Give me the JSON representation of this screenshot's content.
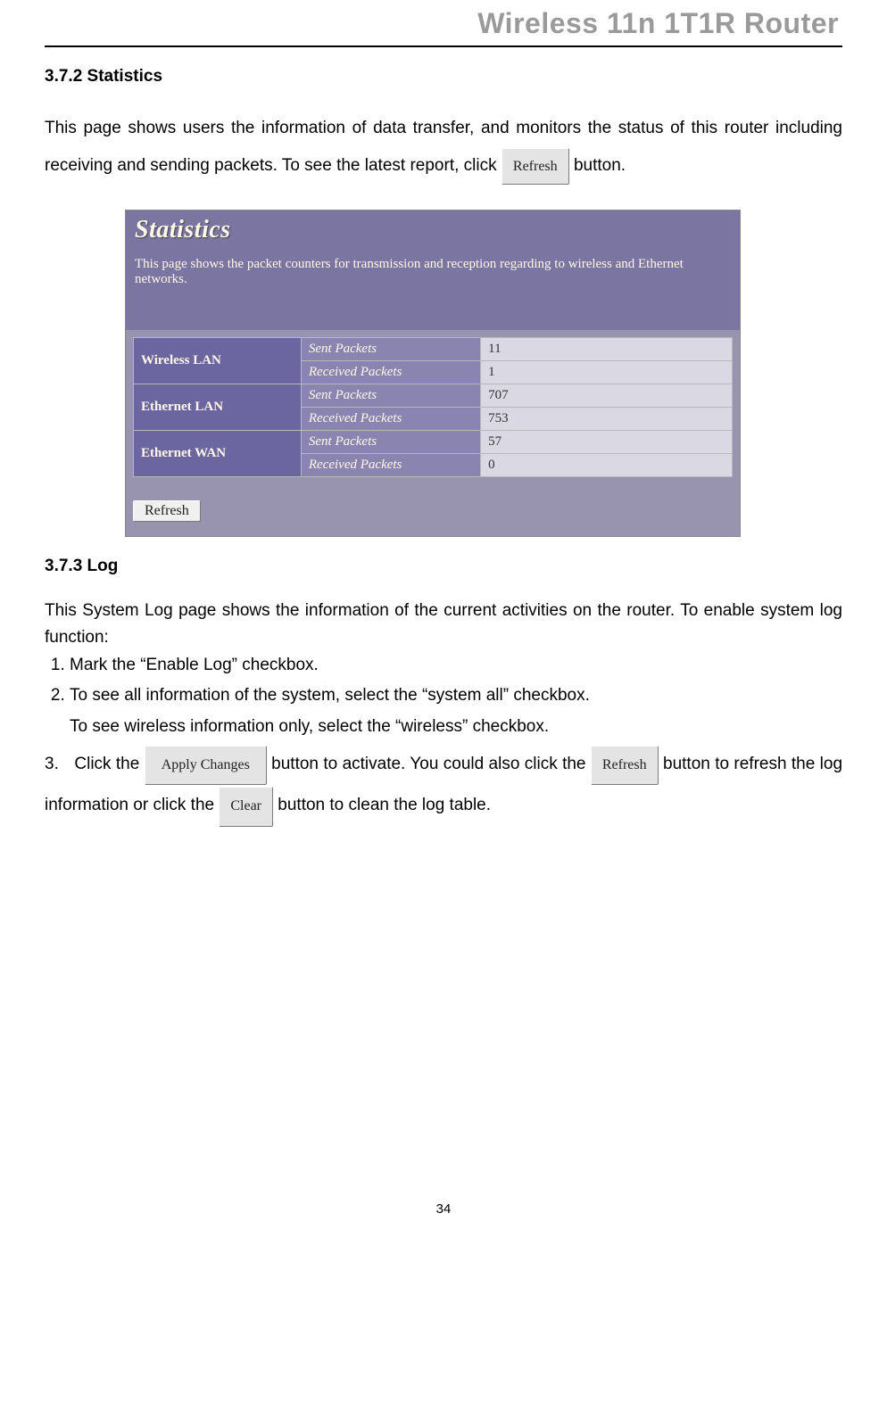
{
  "header": {
    "title": "Wireless 11n 1T1R Router"
  },
  "section_statistics": {
    "heading": "3.7.2 Statistics",
    "intro_part1": "This page shows users the information of data transfer, and monitors the status of this router including receiving and sending packets. To see the latest report, click ",
    "intro_part2": " button.",
    "refresh_btn": "Refresh"
  },
  "screenshot": {
    "title": "Statistics",
    "desc": "This page shows the packet counters for transmission and reception regarding to wireless and Ethernet networks.",
    "rows": [
      {
        "iface": "Wireless LAN",
        "metric": "Sent Packets",
        "value": "11"
      },
      {
        "iface": "",
        "metric": "Received Packets",
        "value": "1"
      },
      {
        "iface": "Ethernet LAN",
        "metric": "Sent Packets",
        "value": "707"
      },
      {
        "iface": "",
        "metric": "Received Packets",
        "value": "753"
      },
      {
        "iface": "Ethernet WAN",
        "metric": "Sent Packets",
        "value": "57"
      },
      {
        "iface": "",
        "metric": "Received Packets",
        "value": "0"
      }
    ],
    "refresh_btn": "Refresh"
  },
  "section_log": {
    "heading": "3.7.3 Log",
    "intro": "This System Log page shows the information of the current activities on the router. To enable system log function:",
    "step1": "Mark the “Enable Log” checkbox.",
    "step2a": "To see all information of the system, select the “system all” checkbox.",
    "step2b": "To see wireless information only, select the “wireless” checkbox.",
    "step3_pre": "Click the ",
    "apply_btn": "Apply Changes",
    "step3_mid": " button to activate. You could also click the ",
    "refresh_btn": "Refresh",
    "step3_post": " button to refresh the log information or click the ",
    "clear_btn": "Clear",
    "step3_end": " button to clean the log table."
  },
  "page_number": "34"
}
